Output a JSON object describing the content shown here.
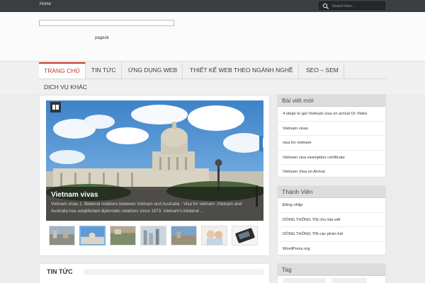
{
  "topbar": {
    "home_link": "Home",
    "search_placeholder": "Search here ..."
  },
  "header": {
    "site_logo_alt": "pageok"
  },
  "nav": {
    "items": [
      "TRANG CHỦ",
      "TIN TỨC",
      "ỨNG DỤNG WEB",
      "THIẾT KẾ WEB THEO NGÀNH NGHỀ",
      "SEO – SEM",
      "DỊCH VỤ KHÁC"
    ]
  },
  "featured": {
    "title": "Vietnam vivas",
    "excerpt": "Vietnam vivas 1. Bilateral relations between Vietnam and Australia  - Visa for vietnam ,Vietnam and Australia has established diplomatic relations since 1973. Vietnam's bilateral ..."
  },
  "content": {
    "section_title": "TIN TỨC"
  },
  "sidebar": {
    "recent_posts": {
      "title": "Bài viết mới",
      "items": [
        "4 steps to get Vietnam visa on arrival Or Video",
        "Vietnam vivas",
        "visa for vietnam",
        "Vietnam visa exemption certificate",
        "Vietnam Visa on Arrival"
      ]
    },
    "members": {
      "title": "Thành Viên",
      "items": [
        "Đăng nhập",
        "DÒNG THÔNG TIN cho bài viết",
        "DÒNG THÔNG TIN các phản hồi",
        "WordPress.org"
      ]
    },
    "tags": {
      "title": "Tag"
    }
  },
  "colors": {
    "accent": "#c0392b",
    "topbar": "#3a3e43",
    "thumb_selected_border": "#7bb3e0"
  },
  "icons": {
    "search": "search-icon",
    "featured_badge": "book-icon"
  }
}
